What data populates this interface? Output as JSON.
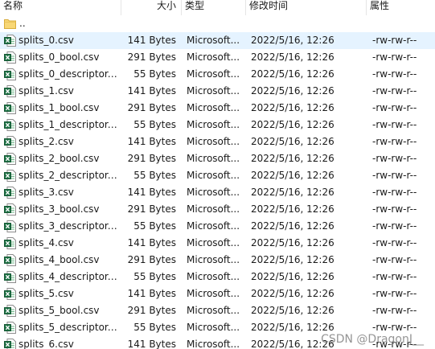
{
  "columns": {
    "name": "名称",
    "size": "大小",
    "type": "类型",
    "modified": "修改时间",
    "attributes": "属性"
  },
  "parent_dir": "..",
  "files": [
    {
      "name": "splits_0.csv",
      "size": "141 Bytes",
      "type": "Microsoft...",
      "modified": "2022/5/16, 12:26",
      "attributes": "-rw-rw-r--"
    },
    {
      "name": "splits_0_bool.csv",
      "size": "291 Bytes",
      "type": "Microsoft...",
      "modified": "2022/5/16, 12:26",
      "attributes": "-rw-rw-r--"
    },
    {
      "name": "splits_0_descriptor....",
      "size": "55 Bytes",
      "type": "Microsoft...",
      "modified": "2022/5/16, 12:26",
      "attributes": "-rw-rw-r--"
    },
    {
      "name": "splits_1.csv",
      "size": "141 Bytes",
      "type": "Microsoft...",
      "modified": "2022/5/16, 12:26",
      "attributes": "-rw-rw-r--"
    },
    {
      "name": "splits_1_bool.csv",
      "size": "291 Bytes",
      "type": "Microsoft...",
      "modified": "2022/5/16, 12:26",
      "attributes": "-rw-rw-r--"
    },
    {
      "name": "splits_1_descriptor....",
      "size": "55 Bytes",
      "type": "Microsoft...",
      "modified": "2022/5/16, 12:26",
      "attributes": "-rw-rw-r--"
    },
    {
      "name": "splits_2.csv",
      "size": "141 Bytes",
      "type": "Microsoft...",
      "modified": "2022/5/16, 12:26",
      "attributes": "-rw-rw-r--"
    },
    {
      "name": "splits_2_bool.csv",
      "size": "291 Bytes",
      "type": "Microsoft...",
      "modified": "2022/5/16, 12:26",
      "attributes": "-rw-rw-r--"
    },
    {
      "name": "splits_2_descriptor....",
      "size": "55 Bytes",
      "type": "Microsoft...",
      "modified": "2022/5/16, 12:26",
      "attributes": "-rw-rw-r--"
    },
    {
      "name": "splits_3.csv",
      "size": "141 Bytes",
      "type": "Microsoft...",
      "modified": "2022/5/16, 12:26",
      "attributes": "-rw-rw-r--"
    },
    {
      "name": "splits_3_bool.csv",
      "size": "291 Bytes",
      "type": "Microsoft...",
      "modified": "2022/5/16, 12:26",
      "attributes": "-rw-rw-r--"
    },
    {
      "name": "splits_3_descriptor....",
      "size": "55 Bytes",
      "type": "Microsoft...",
      "modified": "2022/5/16, 12:26",
      "attributes": "-rw-rw-r--"
    },
    {
      "name": "splits_4.csv",
      "size": "141 Bytes",
      "type": "Microsoft...",
      "modified": "2022/5/16, 12:26",
      "attributes": "-rw-rw-r--"
    },
    {
      "name": "splits_4_bool.csv",
      "size": "291 Bytes",
      "type": "Microsoft...",
      "modified": "2022/5/16, 12:26",
      "attributes": "-rw-rw-r--"
    },
    {
      "name": "splits_4_descriptor....",
      "size": "55 Bytes",
      "type": "Microsoft...",
      "modified": "2022/5/16, 12:26",
      "attributes": "-rw-rw-r--"
    },
    {
      "name": "splits_5.csv",
      "size": "141 Bytes",
      "type": "Microsoft...",
      "modified": "2022/5/16, 12:26",
      "attributes": "-rw-rw-r--"
    },
    {
      "name": "splits_5_bool.csv",
      "size": "291 Bytes",
      "type": "Microsoft...",
      "modified": "2022/5/16, 12:26",
      "attributes": "-rw-rw-r--"
    },
    {
      "name": "splits_5_descriptor....",
      "size": "55 Bytes",
      "type": "Microsoft...",
      "modified": "2022/5/16, 12:26",
      "attributes": "-rw-rw-r--"
    },
    {
      "name": "splits_6.csv",
      "size": "141 Bytes",
      "type": "Microsoft...",
      "modified": "2022/5/16, 12:26",
      "attributes": "-rw-rw-r--"
    }
  ],
  "selected_index": 0,
  "icons": {
    "folder": "folder-up-icon",
    "file": "excel-csv-icon"
  },
  "colors": {
    "selection": "#e5f3ff",
    "excel_green": "#1e7145",
    "folder_yellow": "#f8d775"
  },
  "watermark": "CSDN @DragonJ__"
}
